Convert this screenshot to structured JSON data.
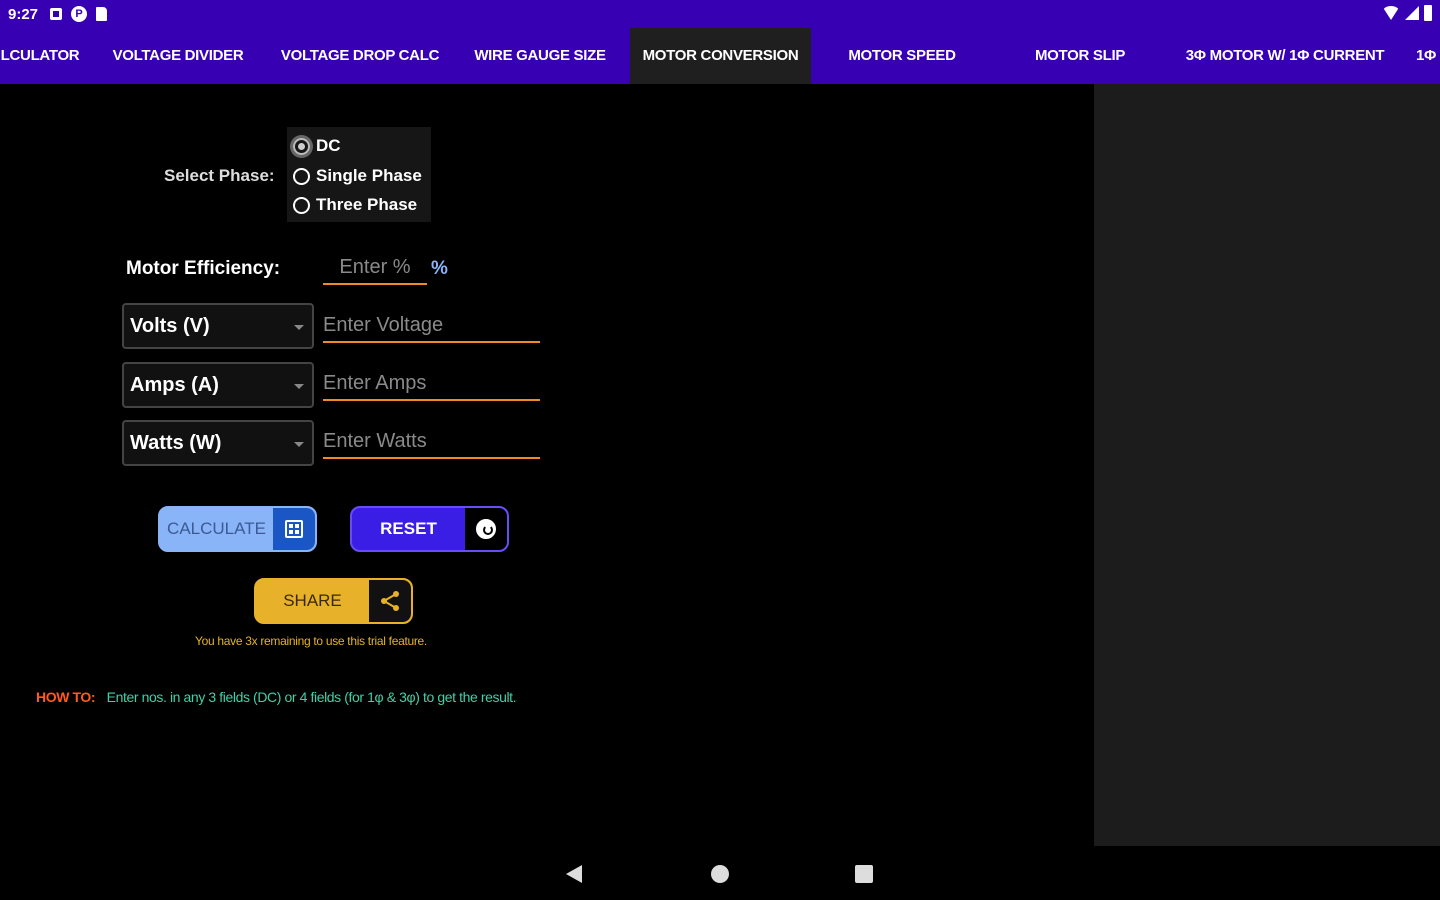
{
  "status_bar": {
    "time": "9:27"
  },
  "tabs": [
    {
      "label": "LCULATOR",
      "active": false
    },
    {
      "label": "VOLTAGE DIVIDER",
      "active": false
    },
    {
      "label": "VOLTAGE DROP CALC",
      "active": false
    },
    {
      "label": "WIRE GAUGE SIZE",
      "active": false
    },
    {
      "label": "MOTOR CONVERSION",
      "active": true
    },
    {
      "label": "MOTOR SPEED",
      "active": false
    },
    {
      "label": "MOTOR SLIP",
      "active": false
    },
    {
      "label": "3Φ MOTOR W/ 1Φ CURRENT",
      "active": false
    },
    {
      "label": "1Φ",
      "active": false
    }
  ],
  "phase": {
    "label": "Select Phase:",
    "options": [
      {
        "label": "DC",
        "checked": true
      },
      {
        "label": "Single Phase",
        "checked": false
      },
      {
        "label": "Three Phase",
        "checked": false
      }
    ]
  },
  "efficiency": {
    "label": "Motor Efficiency:",
    "placeholder": "Enter %",
    "unit": "%"
  },
  "fields": [
    {
      "unit": "Volts (V)",
      "placeholder": "Enter Voltage"
    },
    {
      "unit": "Amps (A)",
      "placeholder": "Enter Amps"
    },
    {
      "unit": "Watts (W)",
      "placeholder": "Enter Watts"
    }
  ],
  "buttons": {
    "calculate": "CALCULATE",
    "reset": "RESET",
    "share": "SHARE"
  },
  "trial_note": "You have 3x remaining to use this trial feature.",
  "howto": {
    "label": "HOW TO:",
    "text": "Enter nos. in any 3 fields (DC) or 4 fields (for 1φ & 3φ) to get the result."
  },
  "colors": {
    "accent": "#3700b3",
    "underline": "#f08a24",
    "calculate": "#8ab4f8",
    "reset": "#3b1ee6",
    "share": "#e8b12a"
  }
}
